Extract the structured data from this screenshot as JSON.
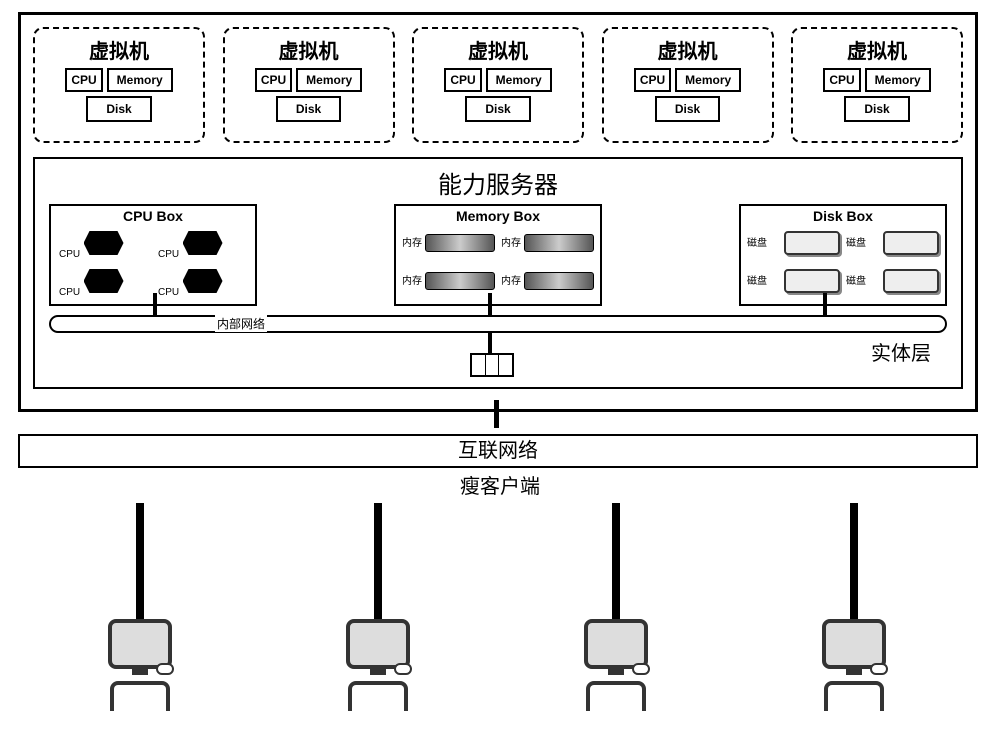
{
  "vm": {
    "title": "虚拟机",
    "cpu": "CPU",
    "memory": "Memory",
    "disk": "Disk",
    "count": 5
  },
  "server": {
    "title": "能力服务器",
    "cpu_box": {
      "title": "CPU Box",
      "item_label": "CPU"
    },
    "memory_box": {
      "title": "Memory Box",
      "item_label": "内存"
    },
    "disk_box": {
      "title": "Disk Box",
      "item_label": "磁盘"
    },
    "bus_label": "内部网络",
    "physical_layer": "实体层"
  },
  "internet": "互联网络",
  "thin_client": "瘦客户端",
  "client_count": 4
}
